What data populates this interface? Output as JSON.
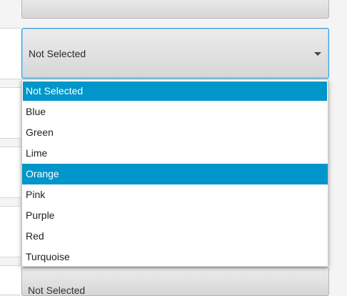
{
  "combo_top": {
    "value": ""
  },
  "combo_main": {
    "value": "Not Selected",
    "arrow_icon": "chevron-down-icon"
  },
  "combo_bottom": {
    "value": "Not Selected"
  },
  "dropdown": {
    "options": [
      {
        "label": "Not Selected",
        "selected": true
      },
      {
        "label": "Blue",
        "selected": false
      },
      {
        "label": "Green",
        "selected": false
      },
      {
        "label": "Lime",
        "selected": false
      },
      {
        "label": "Orange",
        "selected": true
      },
      {
        "label": "Pink",
        "selected": false
      },
      {
        "label": "Purple",
        "selected": false
      },
      {
        "label": "Red",
        "selected": false
      },
      {
        "label": "Turquoise",
        "selected": false
      }
    ]
  },
  "colors": {
    "accent": "#0096c9",
    "focus_border": "#3aa0dc"
  }
}
